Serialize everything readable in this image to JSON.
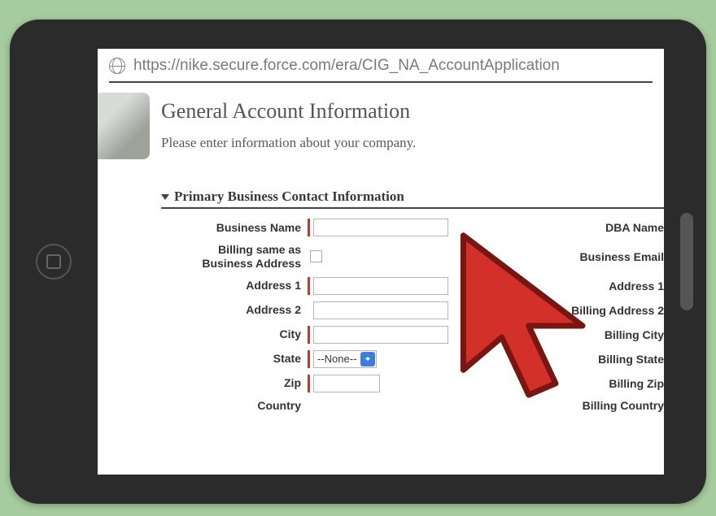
{
  "url": "https://nike.secure.force.com/era/CIG_NA_AccountApplication",
  "page": {
    "title": "General Account Information",
    "subtitle": "Please enter information about your company."
  },
  "section": {
    "header": "Primary Business Contact Information"
  },
  "form": {
    "left_labels": {
      "business_name": "Business Name",
      "billing_same_line1": "Billing same as",
      "billing_same_line2": "Business Address",
      "address1": "Address 1",
      "address2": "Address 2",
      "city": "City",
      "state": "State",
      "zip": "Zip",
      "country": "Country"
    },
    "right_labels": {
      "dba_name": "DBA Name",
      "business_email": "Business Email",
      "b_address1": "Address 1",
      "b_address2": "Billing Address 2",
      "b_city": "Billing City",
      "b_state": "Billing State",
      "b_zip": "Billing Zip",
      "b_country": "Billing Country"
    },
    "state_selected": "--None--"
  }
}
